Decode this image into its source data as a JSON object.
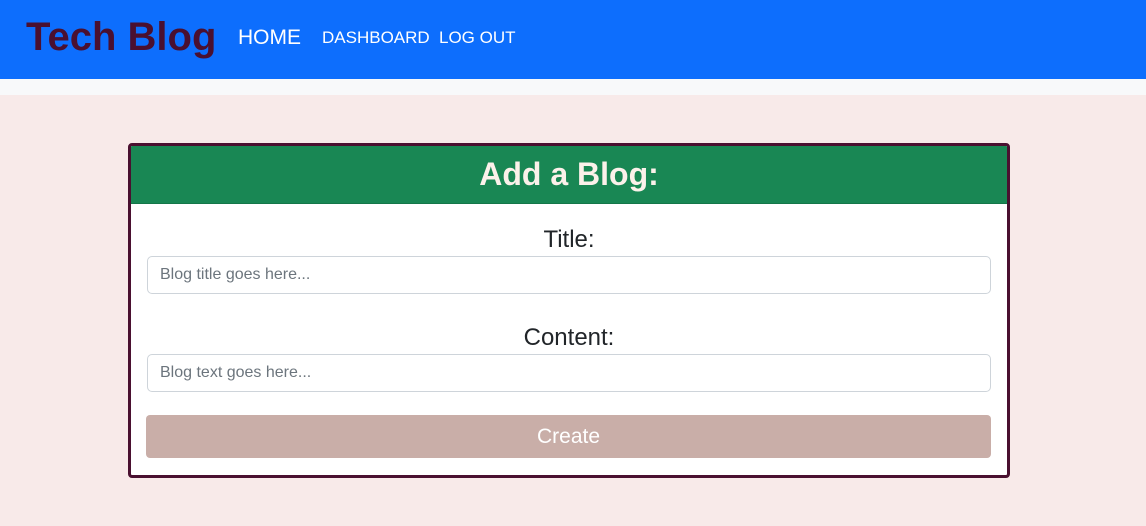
{
  "navbar": {
    "brand": "Tech Blog",
    "links": [
      {
        "label": "HOME"
      },
      {
        "label": "DASHBOARD"
      },
      {
        "label": "LOG OUT"
      }
    ]
  },
  "form": {
    "heading": "Add a Blog:",
    "title_label": "Title:",
    "title_placeholder": "Blog title goes here...",
    "title_value": "",
    "content_label": "Content:",
    "content_placeholder": "Blog text goes here...",
    "content_value": "",
    "submit_label": "Create"
  },
  "colors": {
    "navbar": "#0d6efd",
    "brand_text": "#4a1030",
    "page_background": "#f8eae9",
    "card_header": "#198754",
    "card_border": "#4a1030",
    "create_button": "#c9aea8"
  }
}
